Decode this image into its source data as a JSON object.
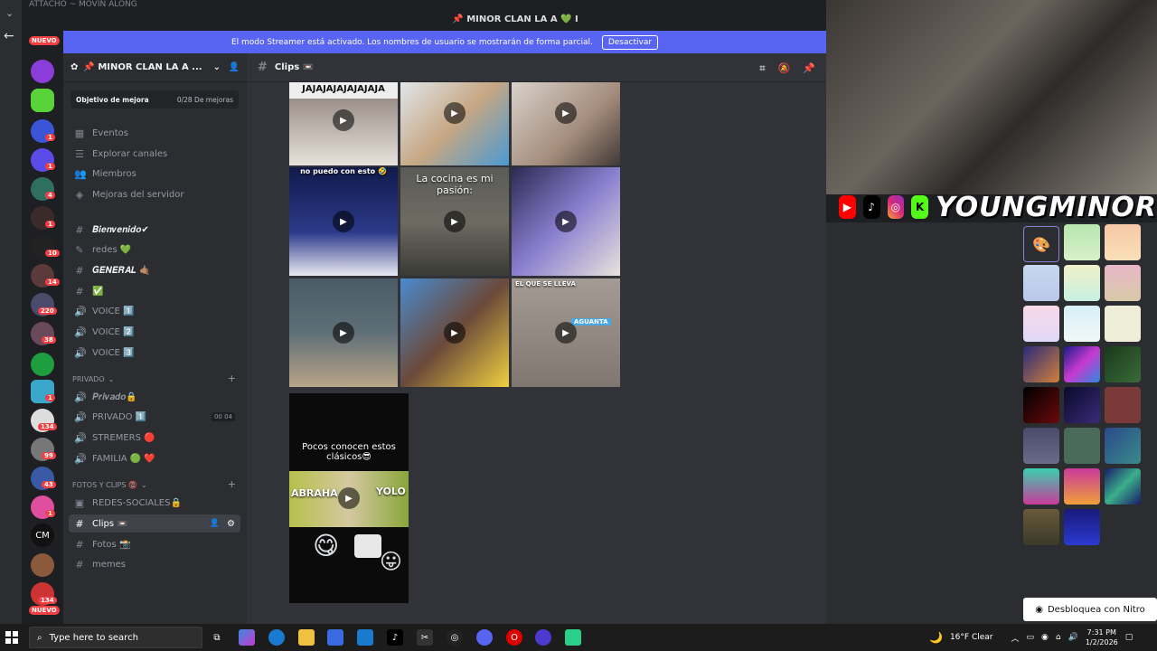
{
  "top": {
    "tab_label": "ATTACHO ~ MOVIN ALONG",
    "server_title": "📌 MINOR CLAN LA A 💚 I"
  },
  "banner": {
    "text": "El modo Streamer está activado. Los nombres de usuario se mostrarán de forma parcial.",
    "button": "Desactivar"
  },
  "guilds": {
    "new_top": "NUEVO",
    "new_bottom": "NUEVO",
    "badges": [
      "1",
      "1",
      "4",
      "1",
      "10",
      "14",
      "220",
      "38",
      "1",
      "134",
      "99",
      "43",
      "1",
      "134"
    ],
    "cm_label": "CM"
  },
  "sidebar": {
    "server_name": "📌 MINOR CLAN LA A ...",
    "goal_label": "Objetivo de mejora",
    "goal_progress": "0/28 De mejoras",
    "nav": [
      "Eventos",
      "Explorar canales",
      "Miembros",
      "Mejoras del servidor"
    ],
    "channels_top": [
      {
        "name": "𝑩𝒊𝒆𝒏𝒗𝒆𝒏𝒊𝒅𝒐✔",
        "icon": "#",
        "bold": true
      },
      {
        "name": "redes 💚",
        "icon": "🛡",
        "bold": false
      },
      {
        "name": "𝑮𝑬𝑵𝑬𝑹𝑨𝑳 🤙🏽",
        "icon": "#",
        "bold": true
      },
      {
        "name": "✅",
        "icon": "#",
        "bold": false
      },
      {
        "name": "VOICE 1️⃣",
        "icon": "🔊",
        "bold": false
      },
      {
        "name": "VOICE 2️⃣",
        "icon": "🔊",
        "bold": false
      },
      {
        "name": "VOICE 3️⃣",
        "icon": "🔊",
        "bold": false
      }
    ],
    "cat_privado": "PRIVADO",
    "channels_priv": [
      {
        "name": "𝑷𝒓𝒊𝒗𝒂𝒅𝒐🔒",
        "icon": "🔊",
        "extra": ""
      },
      {
        "name": "PRIVADO 1️⃣",
        "icon": "🔊",
        "extra": "00  04"
      },
      {
        "name": "STREMERS 🔴",
        "icon": "🔊",
        "extra": ""
      },
      {
        "name": "FAMILIA 🟢 ❤️",
        "icon": "🔊",
        "extra": ""
      }
    ],
    "cat_fotos": "FOTOS Y CLIPS 📵",
    "channels_fotos": [
      {
        "name": "REDES-SOCIALES🔒",
        "icon": "▣"
      },
      {
        "name": "Clips 📼",
        "icon": "#",
        "active": true
      },
      {
        "name": "Fotos 📸",
        "icon": "#"
      },
      {
        "name": "memes",
        "icon": "#"
      }
    ]
  },
  "channel": {
    "name": "Clips 📼"
  },
  "clips": {
    "captions": [
      "JAJAJAJAJAJAJAJA",
      "",
      "",
      "no puedo con esto 🤣",
      "La cocina es mi pasión:",
      "",
      "",
      "",
      "EL QUE SE LLEVA",
      "Pocos conocen estos clásicos😎"
    ],
    "extra_texts": [
      "AGUANTA",
      "ABRAHA",
      "YOLO"
    ]
  },
  "stream": {
    "brand": "YOUNGMINOR",
    "nitro_button": "Desbloquea con Nitro"
  },
  "taskbar": {
    "search_placeholder": "Type here to search",
    "weather": "16°F  Clear",
    "time": "7:31 PM",
    "date": "1/2/2026"
  },
  "colors": {
    "blurple": "#5865f2",
    "sidebar": "#2b2d31",
    "chat": "#313338",
    "dark": "#1e1f22"
  }
}
